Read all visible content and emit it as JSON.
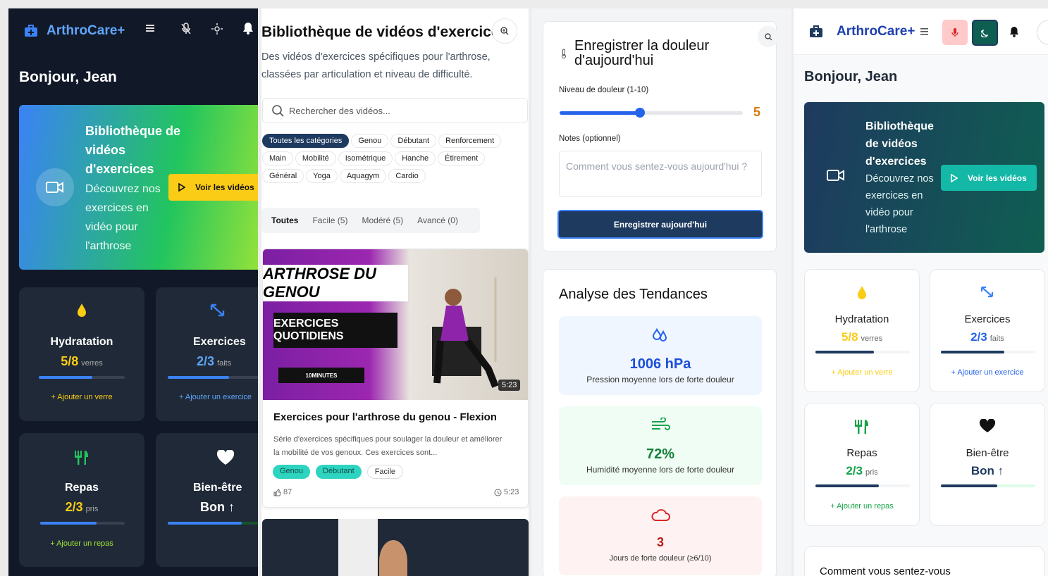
{
  "colors": {
    "dark_bg": "#111827",
    "card_dark": "#1f2937",
    "accent_yellow": "#facc15",
    "navy": "#1e3a5f",
    "teal": "#0f766e",
    "green": "#16a34a",
    "blue": "#2563eb",
    "red": "#b91c1c"
  },
  "dark_panel": {
    "brand": "ArthroCare+",
    "greeting": "Bonjour, Jean",
    "hero": {
      "title": "Bibliothèque de vidéos d'exercices",
      "description": "Découvrez nos exercices en vidéo pour l'arthrose",
      "button": "Voir les vidéos"
    },
    "cards": [
      {
        "title": "Hydratation",
        "value": "5/8",
        "unit": "verres",
        "add": "+ Ajouter un verre",
        "progress": 0.62
      },
      {
        "title": "Exercices",
        "value": "2/3",
        "unit": "faits",
        "add": "+ Ajouter un exercice",
        "progress": 0.67
      },
      {
        "title": "Repas",
        "value": "2/3",
        "unit": "pris",
        "add": "+ Ajouter un repas",
        "progress": 0.67
      },
      {
        "title": "Bien-être",
        "value": "Bon ↑",
        "unit": "",
        "add": "",
        "progress": 0.7
      }
    ]
  },
  "library": {
    "title": "Bibliothèque de vidéos d'exercices",
    "subtitle": "Des vidéos d'exercices spécifiques pour l'arthrose, classées par articulation et niveau de difficulté.",
    "search_placeholder": "Rechercher des vidéos...",
    "categories": [
      "Toutes les catégories",
      "Genou",
      "Débutant",
      "Renforcement",
      "Main",
      "Mobilité",
      "Isométrique",
      "Hanche",
      "Étirement",
      "Général",
      "Yoga",
      "Aquagym",
      "Cardio"
    ],
    "levels": [
      "Toutes",
      "Facile (5)",
      "Modéré (5)",
      "Avancé (0)"
    ],
    "video": {
      "thumb_line1": "ARTHROSE DU GENOU",
      "thumb_line2": "EXERCICES QUOTIDIENS",
      "thumb_line3": "10MINUTES",
      "duration": "5:23",
      "title": "Exercices pour l'arthrose du genou - Flexion",
      "description": "Série d'exercices spécifiques pour soulager la douleur et améliorer la mobilité de vos genoux. Ces exercices sont...",
      "tags": [
        "Genou",
        "Débutant",
        "Facile"
      ],
      "likes": "87",
      "time": "5:23"
    }
  },
  "pain": {
    "title": "Enregistrer la douleur d'aujourd'hui",
    "level_label": "Niveau de douleur (1-10)",
    "level_value": "5",
    "level_fraction": 0.44,
    "notes_label": "Notes (optionnel)",
    "notes_placeholder": "Comment vous sentez-vous aujourd'hui ?",
    "submit": "Enregistrer aujourd'hui"
  },
  "trends": {
    "title": "Analyse des Tendances",
    "stats": [
      {
        "value": "1006 hPa",
        "label": "Pression moyenne lors de forte douleur"
      },
      {
        "value": "72%",
        "label": "Humidité moyenne lors de forte douleur"
      },
      {
        "value": "3",
        "label": "Jours de forte douleur (≥6/10)"
      }
    ]
  },
  "light_panel": {
    "brand": "ArthroCare+",
    "greeting": "Bonjour, Jean",
    "hero": {
      "title": "Bibliothèque de vidéos d'exercices",
      "description": "Découvrez nos exercices en vidéo pour l'arthrose",
      "button": "Voir les vidéos"
    },
    "cards": [
      {
        "title": "Hydratation",
        "value": "5/8",
        "unit": "verres",
        "add": "+ Ajouter un verre",
        "progress": 0.62
      },
      {
        "title": "Exercices",
        "value": "2/3",
        "unit": "faits",
        "add": "+ Ajouter un exercice",
        "progress": 0.67
      },
      {
        "title": "Repas",
        "value": "2/3",
        "unit": "pris",
        "add": "+ Ajouter un repas",
        "progress": 0.67
      },
      {
        "title": "Bien-être",
        "value": "Bon ↑",
        "unit": "",
        "add": "",
        "progress": 0.6
      }
    ],
    "mood_prompt": "Comment vous sentez-vous"
  }
}
